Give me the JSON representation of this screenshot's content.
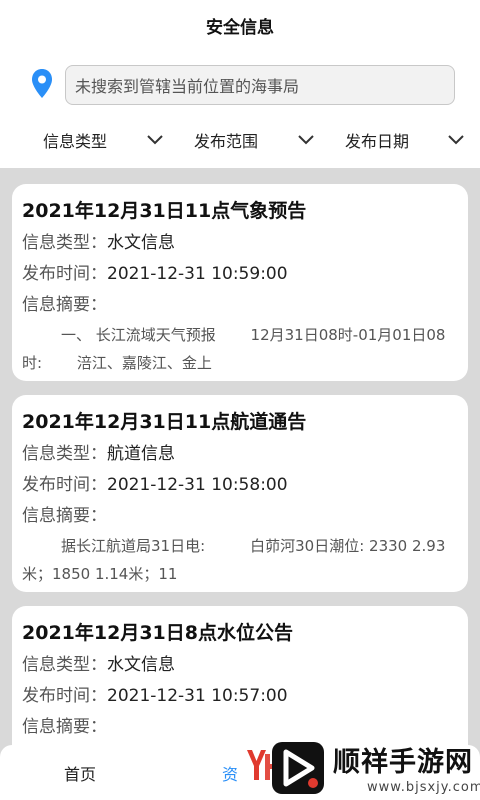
{
  "header": {
    "title": "安全信息"
  },
  "search": {
    "text": "未搜索到管辖当前位置的海事局"
  },
  "filters": [
    {
      "label": "信息类型"
    },
    {
      "label": "发布范围"
    },
    {
      "label": "发布日期"
    }
  ],
  "labels": {
    "type": "信息类型：",
    "time": "发布时间：",
    "summary": "信息摘要："
  },
  "cards": [
    {
      "title": "2021年12月31日11点气象预告",
      "type": "水文信息",
      "time": "2021-12-31 10:59:00",
      "summary": "一、 长江流域天气预报　　 12月31日08时-01月01日08时:　　 涪江、嘉陵江、金上"
    },
    {
      "title": "2021年12月31日11点航道通告",
      "type": "航道信息",
      "time": "2021-12-31 10:58:00",
      "summary": "据长江航道局31日电:　　　白茆河30日潮位: 2330 2.93米；1850 1.14米；11"
    },
    {
      "title": "2021年12月31日8点水位公告",
      "type": "水文信息",
      "time": "2021-12-31 10:57:00",
      "summary": ""
    }
  ],
  "tabs": [
    {
      "label": "首页"
    },
    {
      "label": "资"
    }
  ],
  "watermark": {
    "brand": "顺祥手游网",
    "url": "www.bjsxjy.com"
  },
  "colors": {
    "accent": "#2a8ff7",
    "list_background": "#d9d9d9",
    "watermark_red": "#e03a2f"
  }
}
